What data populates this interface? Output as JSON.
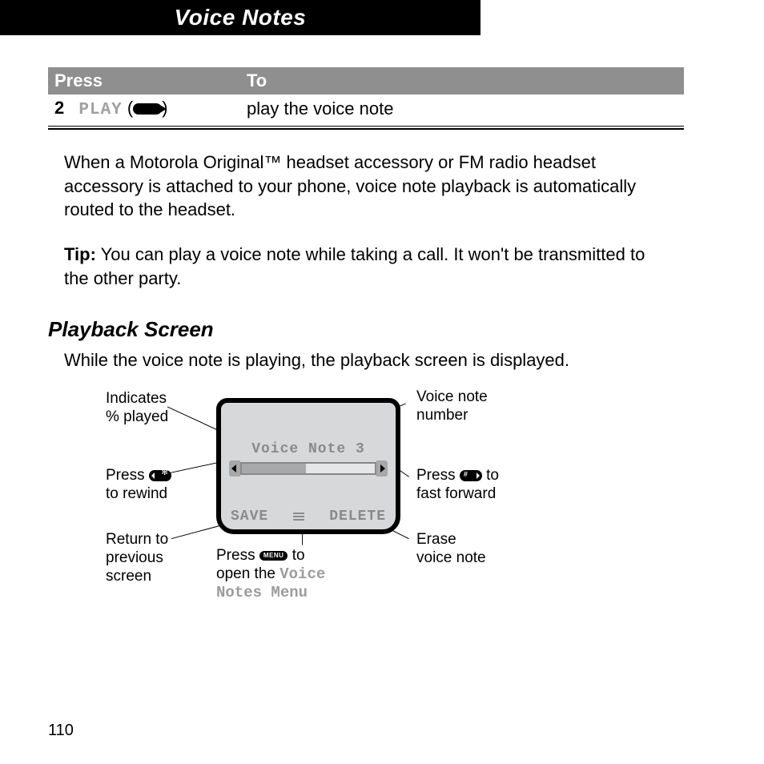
{
  "header": {
    "title": "Voice Notes"
  },
  "table": {
    "col1": "Press",
    "col2": "To",
    "row": {
      "num": "2",
      "key": "PLAY",
      "desc": "play the voice note"
    }
  },
  "paragraphs": {
    "p1": "When a Motorola Original™ headset accessory or FM radio headset accessory is attached to your phone, voice note playback is automatically routed to the headset.",
    "tip_label": "Tip:",
    "tip_body": " You can play a voice note while taking a call. It won't be transmitted to the other party."
  },
  "subhead": "Playback Screen",
  "subtext": "While the voice note is playing, the playback screen is displayed.",
  "screen": {
    "title": "Voice Note 3",
    "save": "SAVE",
    "delete": "DELETE"
  },
  "callouts": {
    "pct": "Indicates\n% played",
    "vnum": "Voice note\nnumber",
    "rewind_a": "Press ",
    "rewind_b": "\nto rewind",
    "ff_a": "Press ",
    "ff_b": " to\nfast forward",
    "ret": "Return to\nprevious\nscreen",
    "menu_a": "Press ",
    "menu_b": " to\nopen the ",
    "menu_c": "Voice\nNotes Menu",
    "erase": "Erase\nvoice note"
  },
  "page": "110"
}
